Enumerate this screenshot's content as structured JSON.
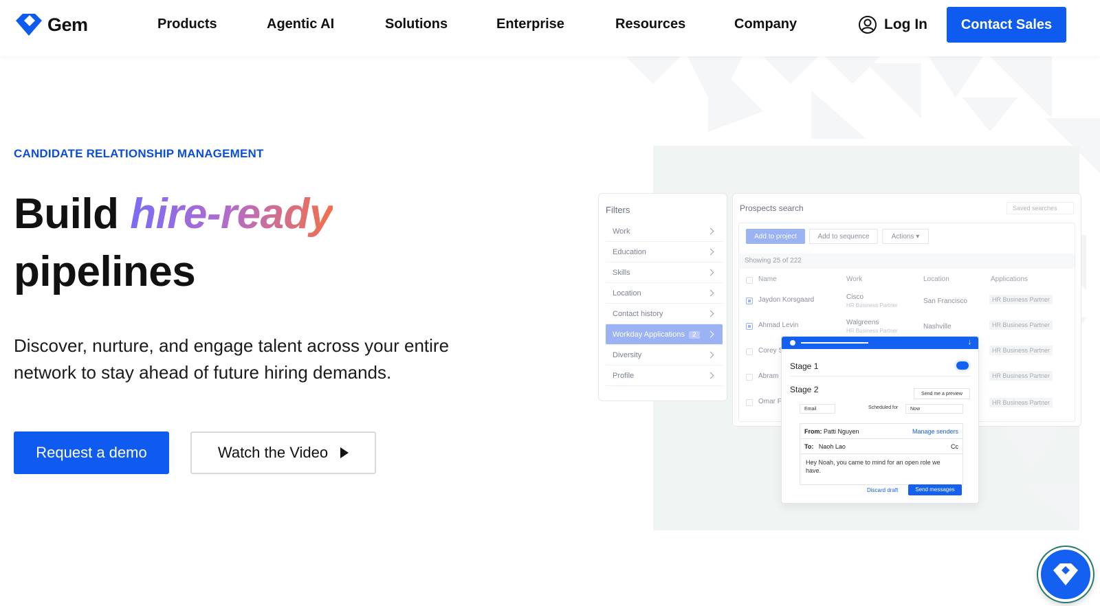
{
  "brand": {
    "name": "Gem",
    "accent": "#0f5bef"
  },
  "nav": {
    "items": [
      "Products",
      "Agentic AI",
      "Solutions",
      "Enterprise",
      "Resources",
      "Company"
    ],
    "login_label": "Log In",
    "contact_label": "Contact Sales"
  },
  "hero": {
    "eyebrow": "CANDIDATE RELATIONSHIP MANAGEMENT",
    "headline_start": "Build ",
    "headline_highlight": "hire-ready",
    "headline_end": "pipelines",
    "subtitle": "Discover, nurture, and engage talent across your entire network to stay ahead of future hiring demands.",
    "cta_primary": "Request a demo",
    "cta_secondary": "Watch the Video"
  },
  "mockup": {
    "filters": {
      "title": "Filters",
      "items": [
        "Work",
        "Education",
        "Skills",
        "Location",
        "Contact history",
        "Workday Applications",
        "Diversity",
        "Profile"
      ],
      "active_item": "Workday Applications",
      "active_count": "2"
    },
    "prospects": {
      "title": "Prospects search",
      "saved_searches": "Saved searches",
      "add_to_project": "Add to project",
      "add_to_sequence": "Add to sequence",
      "actions": "Actions",
      "showing": "Showing 25 of 222",
      "columns": [
        "Name",
        "Work",
        "Location",
        "Applications"
      ],
      "rows": [
        {
          "name": "Jaydon Korsgaard",
          "work": "Cisco",
          "role": "HR Business Partner",
          "location": "San Francisco",
          "application": "HR Business Partner",
          "checked": true
        },
        {
          "name": "Ahmad Levin",
          "work": "Walgreens",
          "role": "HR Business Partner",
          "location": "Nashville",
          "application": "HR Business Partner",
          "checked": true
        },
        {
          "name": "Corey S",
          "work": "",
          "role": "",
          "location": "",
          "application": "HR Business Partner",
          "checked": false
        },
        {
          "name": "Abram",
          "work": "",
          "role": "",
          "location": "",
          "application": "HR Business Partner",
          "checked": false
        },
        {
          "name": "Omar F",
          "work": "",
          "role": "",
          "location": "",
          "application": "HR Business Partner",
          "checked": false
        }
      ]
    },
    "sequence": {
      "stage1": "Stage 1",
      "stage2": "Stage 2",
      "send_preview": "Send me a preview",
      "channel": "Email",
      "scheduled_label": "Scheduled for",
      "scheduled_value": "Now",
      "from_label": "From:",
      "from_value": "Patti Nguyen",
      "manage_senders": "Manage senders",
      "to_label": "To:",
      "to_value": "Naoh Lao",
      "cc": "Cc",
      "body": "Hey Noah, you came to mind for an open role we have.",
      "discard": "Discard draft",
      "send": "Send messages"
    }
  }
}
